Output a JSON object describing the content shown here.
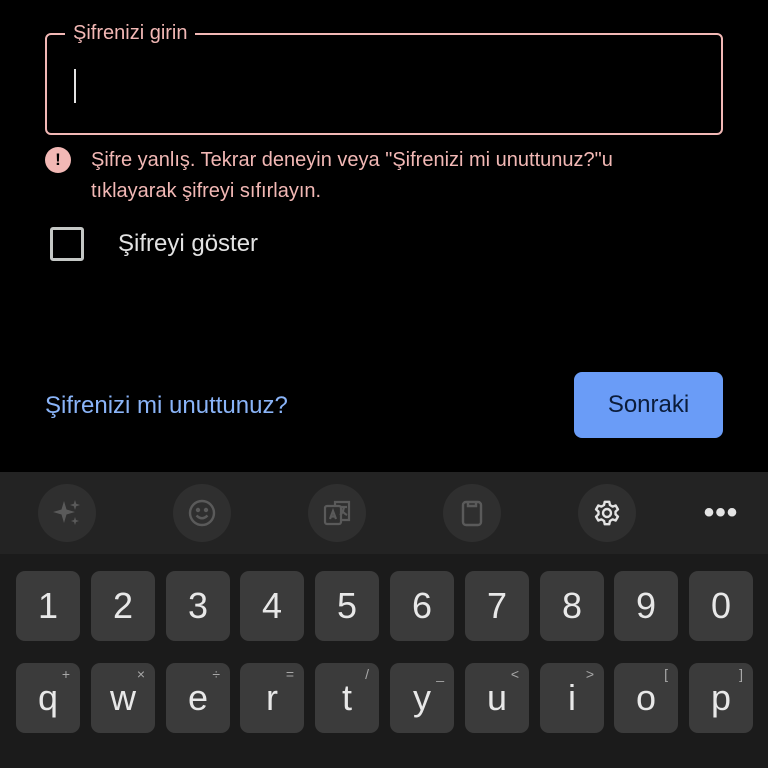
{
  "password": {
    "label": "Şifrenizi girin",
    "value": ""
  },
  "error": {
    "icon": "exclamation-circle-icon",
    "icon_glyph": "!",
    "message": "Şifre yanlış. Tekrar deneyin veya \"Şifrenizi mi unuttunuz?\"u tıklayarak şifreyi sıfırlayın."
  },
  "show_password": {
    "label": "Şifreyi göster",
    "checked": false
  },
  "actions": {
    "forgot_link": "Şifrenizi mi unuttunuz?",
    "next_button": "Sonraki"
  },
  "colors": {
    "error": "#f2b8b5",
    "link": "#8ab4f8",
    "primary_button": "#6a9cf7"
  },
  "keyboard": {
    "toolbar": [
      "sparkle-icon",
      "emoji-icon",
      "translate-icon",
      "clipboard-icon",
      "settings-icon",
      "more-icon"
    ],
    "more_glyph": "•••",
    "number_row": [
      "1",
      "2",
      "3",
      "4",
      "5",
      "6",
      "7",
      "8",
      "9",
      "0"
    ],
    "letter_row": [
      {
        "key": "q",
        "alt": "+"
      },
      {
        "key": "w",
        "alt": "×"
      },
      {
        "key": "e",
        "alt": "÷"
      },
      {
        "key": "r",
        "alt": "="
      },
      {
        "key": "t",
        "alt": "/"
      },
      {
        "key": "y",
        "alt": "_"
      },
      {
        "key": "u",
        "alt": "<"
      },
      {
        "key": "i",
        "alt": ">"
      },
      {
        "key": "o",
        "alt": "["
      },
      {
        "key": "p",
        "alt": "]"
      }
    ]
  }
}
